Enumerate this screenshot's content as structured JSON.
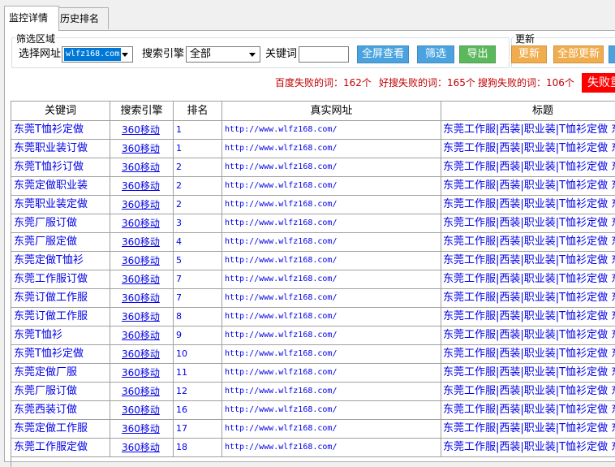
{
  "tabs": [
    {
      "label": "监控详情",
      "active": true
    },
    {
      "label": "历史排名",
      "active": false
    }
  ],
  "filter": {
    "group_title": "筛选区域",
    "site_label": "选择网址",
    "site_value": "wlfz168.com",
    "engine_label": "搜索引擎",
    "engine_value": "全部",
    "keyword_label": "关键词",
    "keyword_value": "",
    "buttons": {
      "fullscreen": "全屏查看",
      "filter": "筛选",
      "export": "导出"
    }
  },
  "update": {
    "group_title": "更新",
    "buttons": {
      "update": "更新",
      "update_all": "全部更新"
    }
  },
  "stats": {
    "baidu_fail": "百度失败的词：162个",
    "haosou_fail": "好搜失败的词：165个",
    "sogou_fail": "搜狗失败的词：106个",
    "fail_button": "失败重"
  },
  "colors": {
    "blue_button": "#4aa3df",
    "green_button": "#5cb85c",
    "orange_button": "#f0ad4e",
    "fail_red": "#ff0000",
    "stat_text": "#c00000",
    "link": "#0000e8"
  },
  "table": {
    "columns": [
      "关键词",
      "搜索引擎",
      "排名",
      "真实网址",
      "标题"
    ],
    "rows": [
      [
        "东莞T恤衫定做",
        "360移动",
        "1",
        "http://www.wlfz168.com/",
        "东莞工作服|西装|职业装|T恤衫定做 东莞"
      ],
      [
        "东莞职业装订做",
        "360移动",
        "1",
        "http://www.wlfz168.com/",
        "东莞工作服|西装|职业装|T恤衫定做 东莞"
      ],
      [
        "东莞T恤衫订做",
        "360移动",
        "2",
        "http://www.wlfz168.com/",
        "东莞工作服|西装|职业装|T恤衫定做 东莞"
      ],
      [
        "东莞定做职业装",
        "360移动",
        "2",
        "http://www.wlfz168.com/",
        "东莞工作服|西装|职业装|T恤衫定做 东莞"
      ],
      [
        "东莞职业装定做",
        "360移动",
        "2",
        "http://www.wlfz168.com/",
        "东莞工作服|西装|职业装|T恤衫定做 东莞"
      ],
      [
        "东莞厂服订做",
        "360移动",
        "3",
        "http://www.wlfz168.com/",
        "东莞工作服|西装|职业装|T恤衫定做 东莞"
      ],
      [
        "东莞厂服定做",
        "360移动",
        "4",
        "http://www.wlfz168.com/",
        "东莞工作服|西装|职业装|T恤衫定做 东莞"
      ],
      [
        "东莞定做T恤衫",
        "360移动",
        "5",
        "http://www.wlfz168.com/",
        "东莞工作服|西装|职业装|T恤衫定做 东莞"
      ],
      [
        "东莞工作服订做",
        "360移动",
        "7",
        "http://www.wlfz168.com/",
        "东莞工作服|西装|职业装|T恤衫定做 东莞"
      ],
      [
        "东莞订做工作服",
        "360移动",
        "7",
        "http://www.wlfz168.com/",
        "东莞工作服|西装|职业装|T恤衫定做 东莞"
      ],
      [
        "东莞订做工作服",
        "360移动",
        "8",
        "http://www.wlfz168.com/",
        "东莞工作服|西装|职业装|T恤衫定做 东莞"
      ],
      [
        "东莞T恤衫",
        "360移动",
        "9",
        "http://www.wlfz168.com/",
        "东莞工作服|西装|职业装|T恤衫定做 东莞"
      ],
      [
        "东莞T恤衫定做",
        "360移动",
        "10",
        "http://www.wlfz168.com/",
        "东莞工作服|西装|职业装|T恤衫定做 东莞"
      ],
      [
        "东莞定做厂服",
        "360移动",
        "11",
        "http://www.wlfz168.com/",
        "东莞工作服|西装|职业装|T恤衫定做 东莞"
      ],
      [
        "东莞厂服订做",
        "360移动",
        "12",
        "http://www.wlfz168.com/",
        "东莞工作服|西装|职业装|T恤衫定做 东莞"
      ],
      [
        "东莞西装订做",
        "360移动",
        "16",
        "http://www.wlfz168.com/",
        "东莞工作服|西装|职业装|T恤衫定做 东莞"
      ],
      [
        "东莞定做工作服",
        "360移动",
        "17",
        "http://www.wlfz168.com/",
        "东莞工作服|西装|职业装|T恤衫定做 东莞"
      ],
      [
        "东莞工作服定做",
        "360移动",
        "18",
        "http://www.wlfz168.com/",
        "东莞工作服|西装|职业装|T恤衫定做 东莞"
      ]
    ]
  }
}
